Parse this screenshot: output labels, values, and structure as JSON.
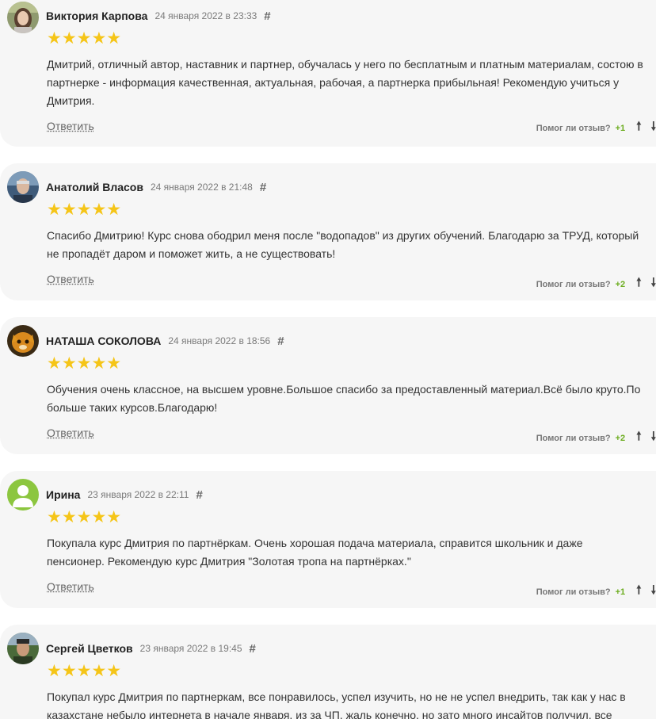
{
  "reviews": [
    {
      "author": "Виктория Карпова",
      "date": "24 января 2022 в 23:33",
      "hash": "#",
      "stars": "★★★★★",
      "lines": [
        "Дмитрий, отличный автор, наставник и партнер, обучалась у него по бесплатным и платным материалам, состою в",
        "партнерке - информация качественная, актуальная, рабочая, а партнерка прибыльная! Рекомендую учиться у",
        "Дмитрия."
      ],
      "reply_label": "Ответить",
      "helpful_question": "Помог ли отзыв?",
      "helpful_count": "+1",
      "up_arrow": "🠕",
      "down_arrow": "🠗"
    },
    {
      "author": "Анатолий Власов",
      "date": "24 января 2022 в 21:48",
      "hash": "#",
      "stars": "★★★★★",
      "lines": [
        "Спасибо Дмитрию! Курс снова ободрил меня после \"водопадов\" из других обучений. Благодарю за ТРУД, который",
        "не пропадёт даром и поможет жить, а не существовать!"
      ],
      "reply_label": "Ответить",
      "helpful_question": "Помог ли отзыв?",
      "helpful_count": "+2",
      "up_arrow": "🠕",
      "down_arrow": "🠗"
    },
    {
      "author": "НАТАША СОКОЛОВА",
      "date": "24 января 2022 в 18:56",
      "hash": "#",
      "stars": "★★★★★",
      "lines": [
        "Обучения очень классное, на высшем уровне.Большое спасибо за предоставленный материал.Всё было круто.По",
        "больше таких курсов.Благодарю!"
      ],
      "reply_label": "Ответить",
      "helpful_question": "Помог ли отзыв?",
      "helpful_count": "+2",
      "up_arrow": "🠕",
      "down_arrow": "🠗"
    },
    {
      "author": "Ирина",
      "date": "23 января 2022 в 22:11",
      "hash": "#",
      "stars": "★★★★★",
      "lines": [
        "Покупала курс Дмитрия по партнёркам. Очень хорошая подача материала, справится школьник и даже",
        "пенсионер. Рекомендую курс Дмитрия \"Золотая тропа на партнёрках.\""
      ],
      "reply_label": "Ответить",
      "helpful_question": "Помог ли отзыв?",
      "helpful_count": "+1",
      "up_arrow": "🠕",
      "down_arrow": "🠗"
    },
    {
      "author": "Сергей Цветков",
      "date": "23 января 2022 в 19:45",
      "hash": "#",
      "stars": "★★★★★",
      "lines": [
        "Покупал курс Дмитрия по партнеркам, все понравилось, успел изучить, но не не успел внедрить, так как у нас в",
        "казахстане небыло интернета в начале января, из за ЧП, жаль конечно, но зато много инсайтов получил, все"
      ],
      "reply_label": "",
      "helpful_question": "",
      "helpful_count": "",
      "up_arrow": "",
      "down_arrow": ""
    }
  ]
}
